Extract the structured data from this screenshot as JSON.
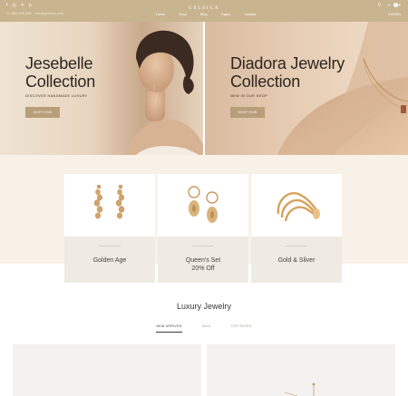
{
  "topbar": {
    "social_icons": [
      "facebook-icon",
      "instagram-icon",
      "twitter-icon",
      "pinterest-icon"
    ],
    "phone": "+1 800 000 000 · info@gelsica.com",
    "brand": "GELSICA",
    "nav": [
      "Home",
      "Shop",
      "Blog",
      "Pages",
      "Contact"
    ],
    "cart_count": "0",
    "region": "EUR/EN"
  },
  "hero": [
    {
      "title_line1": "Jesebelle",
      "title_line2": "Collection",
      "subtitle": "DISCOVER HANDMADE LUXURY",
      "button": "SHOP NOW"
    },
    {
      "title_line1": "Diadora Jewelry",
      "title_line2": "Collection",
      "subtitle": "NEW IN OUR SHOP",
      "button": "SHOP NOW"
    }
  ],
  "categories": [
    {
      "name": "Golden Age"
    },
    {
      "name_line1": "Queen's Set",
      "name_line2": "20% Off"
    },
    {
      "name": "Gold & Silver"
    }
  ],
  "section": {
    "title": "Luxury Jewelry",
    "tabs": [
      "NEW ARRIVED",
      "SALE",
      "TOP RATED"
    ]
  },
  "colors": {
    "topbar": "#c8b48f",
    "accent_button": "#b89f7a",
    "band": "#f8f1e8"
  }
}
